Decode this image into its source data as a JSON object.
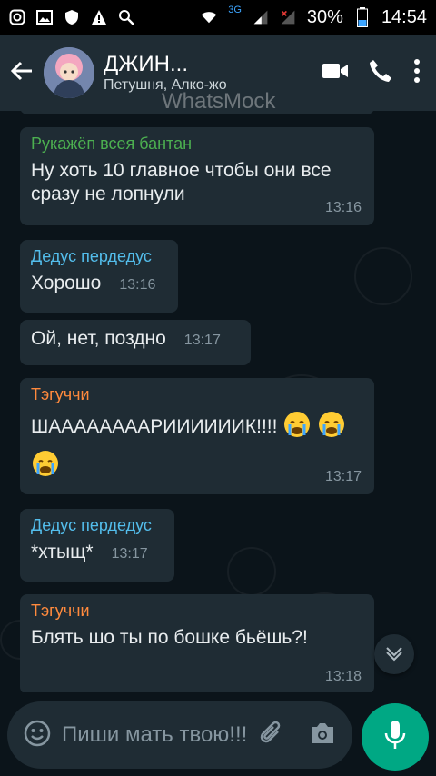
{
  "statusbar": {
    "network_label": "3G",
    "battery": "30%",
    "time": "14:54"
  },
  "header": {
    "title": "ДЖИН...",
    "subtitle": "Петушня, Алко-жо",
    "watermark": "WhatsMock"
  },
  "messages": [
    {
      "sender": "Рукажёп всея бантан",
      "sender_color": "#4caf50",
      "text": "Ну хоть 10 главное чтобы они все сразу не лопнули",
      "time": "13:16"
    },
    {
      "sender": "Дедус пердедус",
      "sender_color": "#53bdeb",
      "text": "Хорошо",
      "time": "13:16"
    },
    {
      "sender": "",
      "sender_color": "",
      "text": "Ой, нет, поздно",
      "time": "13:17"
    },
    {
      "sender": "Тэгуччи",
      "sender_color": "#ff8a3d",
      "text": "ШААААААААРИИИИИИК!!!!",
      "time": "13:17",
      "emoji_count": 3
    },
    {
      "sender": "Дедус пердедус",
      "sender_color": "#53bdeb",
      "text": "*хтыщ*",
      "time": "13:17"
    },
    {
      "sender": "Тэгуччи",
      "sender_color": "#ff8a3d",
      "text": "Блять шо ты по бошке бьёшь?!",
      "time": "13:18"
    }
  ],
  "composer": {
    "placeholder": "Пиши мать твою!!!"
  },
  "icons": {
    "back": "arrow-left-icon",
    "video": "video-camera-icon",
    "call": "phone-icon",
    "menu": "more-vert-icon",
    "emoji": "emoji-icon",
    "attach": "paperclip-icon",
    "camera": "camera-icon",
    "mic": "mic-icon",
    "scroll": "chevron-down-icon"
  }
}
